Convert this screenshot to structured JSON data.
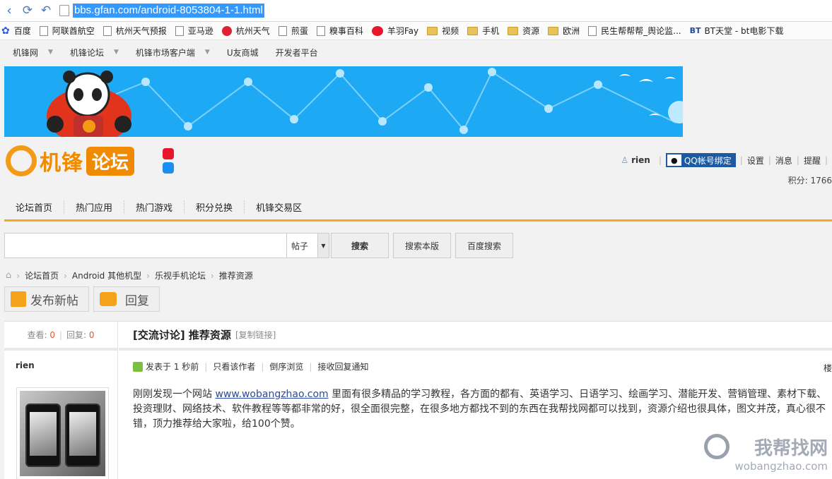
{
  "browser": {
    "url": "bbs.gfan.com/android-8053804-1-1.html",
    "bookmarks": [
      {
        "label": "百度",
        "icon": "paw-icon"
      },
      {
        "label": "阿联酋航空",
        "icon": "page-icon"
      },
      {
        "label": "杭州天气预报",
        "icon": "page-icon"
      },
      {
        "label": "亚马逊",
        "icon": "page-icon"
      },
      {
        "label": "杭州天气",
        "icon": "red-circle-icon"
      },
      {
        "label": "煎蛋",
        "icon": "page-icon"
      },
      {
        "label": "糗事百科",
        "icon": "page-icon"
      },
      {
        "label": "羊羽Fay",
        "icon": "weibo-icon"
      },
      {
        "label": "视频",
        "icon": "folder-icon"
      },
      {
        "label": "手机",
        "icon": "folder-icon"
      },
      {
        "label": "资源",
        "icon": "folder-icon"
      },
      {
        "label": "欧洲",
        "icon": "folder-icon"
      },
      {
        "label": "民生帮帮帮_舆论监...",
        "icon": "page-icon"
      },
      {
        "label": "BT天堂 - bt电影下载",
        "icon": "bt-icon"
      }
    ]
  },
  "topnav": [
    {
      "label": "机锋网",
      "dropdown": true
    },
    {
      "label": "机锋论坛",
      "dropdown": true
    },
    {
      "label": "机锋市场客户端",
      "dropdown": true
    },
    {
      "label": "U友商城",
      "dropdown": false
    },
    {
      "label": "开发者平台",
      "dropdown": false
    }
  ],
  "header": {
    "logo_text": "机锋",
    "logo_box": "论坛",
    "username": "rien",
    "qq_button": "QQ帐号绑定",
    "links": [
      "设置",
      "消息",
      "提醒"
    ],
    "points": "积分: 1766"
  },
  "mainnav": [
    "论坛首页",
    "热门应用",
    "热门游戏",
    "积分兑换",
    "机锋交易区"
  ],
  "search": {
    "type_selected": "帖子",
    "search_button": "搜索",
    "search_board_button": "搜索本版",
    "baidu_button": "百度搜索"
  },
  "breadcrumb": [
    "论坛首页",
    "Android 其他机型",
    "乐视手机论坛",
    "推荐资源"
  ],
  "actions": {
    "new_post": "发布新帖",
    "reply": "回复"
  },
  "post": {
    "views_label": "查看:",
    "views": "0",
    "replies_label": "回复:",
    "replies": "0",
    "title": "[交流讨论] 推荐资源",
    "copy_link": "[复制链接]",
    "author": "rien",
    "posted": "发表于 1 秒前",
    "only_author": "只看该作者",
    "reverse": "倒序浏览",
    "notify": "接收回复通知",
    "floor": "楼",
    "body_before": "刚刚发现一个网站 ",
    "body_link": "www.wobangzhao.com",
    "body_after": " 里面有很多精品的学习教程，各方面的都有、英语学习、日语学习、绘画学习、潜能开发、营销管理、素材下载、投资理财、网络技术、软件教程等等都非常的好，很全面很完整，在很多地方都找不到的东西在我帮找网都可以找到，资源介绍也很具体，图文并茂，真心很不错，顶力推荐给大家啦，给100个赞。"
  },
  "watermark": {
    "cn": "我帮找网",
    "en": "wobangzhao.com"
  },
  "colors": {
    "accent": "#f5a623",
    "banner": "#1ea9f4",
    "link": "#2b4a9a",
    "qq": "#1d5aa0"
  }
}
